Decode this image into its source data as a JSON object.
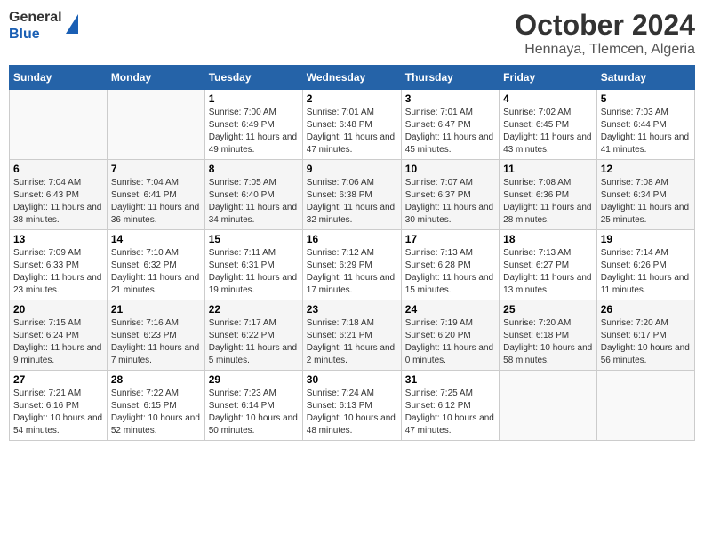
{
  "header": {
    "logo_general": "General",
    "logo_blue": "Blue",
    "month_title": "October 2024",
    "location": "Hennaya, Tlemcen, Algeria"
  },
  "weekdays": [
    "Sunday",
    "Monday",
    "Tuesday",
    "Wednesday",
    "Thursday",
    "Friday",
    "Saturday"
  ],
  "weeks": [
    [
      {
        "day": "",
        "sunrise": "",
        "sunset": "",
        "daylight": ""
      },
      {
        "day": "",
        "sunrise": "",
        "sunset": "",
        "daylight": ""
      },
      {
        "day": "1",
        "sunrise": "Sunrise: 7:00 AM",
        "sunset": "Sunset: 6:49 PM",
        "daylight": "Daylight: 11 hours and 49 minutes."
      },
      {
        "day": "2",
        "sunrise": "Sunrise: 7:01 AM",
        "sunset": "Sunset: 6:48 PM",
        "daylight": "Daylight: 11 hours and 47 minutes."
      },
      {
        "day": "3",
        "sunrise": "Sunrise: 7:01 AM",
        "sunset": "Sunset: 6:47 PM",
        "daylight": "Daylight: 11 hours and 45 minutes."
      },
      {
        "day": "4",
        "sunrise": "Sunrise: 7:02 AM",
        "sunset": "Sunset: 6:45 PM",
        "daylight": "Daylight: 11 hours and 43 minutes."
      },
      {
        "day": "5",
        "sunrise": "Sunrise: 7:03 AM",
        "sunset": "Sunset: 6:44 PM",
        "daylight": "Daylight: 11 hours and 41 minutes."
      }
    ],
    [
      {
        "day": "6",
        "sunrise": "Sunrise: 7:04 AM",
        "sunset": "Sunset: 6:43 PM",
        "daylight": "Daylight: 11 hours and 38 minutes."
      },
      {
        "day": "7",
        "sunrise": "Sunrise: 7:04 AM",
        "sunset": "Sunset: 6:41 PM",
        "daylight": "Daylight: 11 hours and 36 minutes."
      },
      {
        "day": "8",
        "sunrise": "Sunrise: 7:05 AM",
        "sunset": "Sunset: 6:40 PM",
        "daylight": "Daylight: 11 hours and 34 minutes."
      },
      {
        "day": "9",
        "sunrise": "Sunrise: 7:06 AM",
        "sunset": "Sunset: 6:38 PM",
        "daylight": "Daylight: 11 hours and 32 minutes."
      },
      {
        "day": "10",
        "sunrise": "Sunrise: 7:07 AM",
        "sunset": "Sunset: 6:37 PM",
        "daylight": "Daylight: 11 hours and 30 minutes."
      },
      {
        "day": "11",
        "sunrise": "Sunrise: 7:08 AM",
        "sunset": "Sunset: 6:36 PM",
        "daylight": "Daylight: 11 hours and 28 minutes."
      },
      {
        "day": "12",
        "sunrise": "Sunrise: 7:08 AM",
        "sunset": "Sunset: 6:34 PM",
        "daylight": "Daylight: 11 hours and 25 minutes."
      }
    ],
    [
      {
        "day": "13",
        "sunrise": "Sunrise: 7:09 AM",
        "sunset": "Sunset: 6:33 PM",
        "daylight": "Daylight: 11 hours and 23 minutes."
      },
      {
        "day": "14",
        "sunrise": "Sunrise: 7:10 AM",
        "sunset": "Sunset: 6:32 PM",
        "daylight": "Daylight: 11 hours and 21 minutes."
      },
      {
        "day": "15",
        "sunrise": "Sunrise: 7:11 AM",
        "sunset": "Sunset: 6:31 PM",
        "daylight": "Daylight: 11 hours and 19 minutes."
      },
      {
        "day": "16",
        "sunrise": "Sunrise: 7:12 AM",
        "sunset": "Sunset: 6:29 PM",
        "daylight": "Daylight: 11 hours and 17 minutes."
      },
      {
        "day": "17",
        "sunrise": "Sunrise: 7:13 AM",
        "sunset": "Sunset: 6:28 PM",
        "daylight": "Daylight: 11 hours and 15 minutes."
      },
      {
        "day": "18",
        "sunrise": "Sunrise: 7:13 AM",
        "sunset": "Sunset: 6:27 PM",
        "daylight": "Daylight: 11 hours and 13 minutes."
      },
      {
        "day": "19",
        "sunrise": "Sunrise: 7:14 AM",
        "sunset": "Sunset: 6:26 PM",
        "daylight": "Daylight: 11 hours and 11 minutes."
      }
    ],
    [
      {
        "day": "20",
        "sunrise": "Sunrise: 7:15 AM",
        "sunset": "Sunset: 6:24 PM",
        "daylight": "Daylight: 11 hours and 9 minutes."
      },
      {
        "day": "21",
        "sunrise": "Sunrise: 7:16 AM",
        "sunset": "Sunset: 6:23 PM",
        "daylight": "Daylight: 11 hours and 7 minutes."
      },
      {
        "day": "22",
        "sunrise": "Sunrise: 7:17 AM",
        "sunset": "Sunset: 6:22 PM",
        "daylight": "Daylight: 11 hours and 5 minutes."
      },
      {
        "day": "23",
        "sunrise": "Sunrise: 7:18 AM",
        "sunset": "Sunset: 6:21 PM",
        "daylight": "Daylight: 11 hours and 2 minutes."
      },
      {
        "day": "24",
        "sunrise": "Sunrise: 7:19 AM",
        "sunset": "Sunset: 6:20 PM",
        "daylight": "Daylight: 11 hours and 0 minutes."
      },
      {
        "day": "25",
        "sunrise": "Sunrise: 7:20 AM",
        "sunset": "Sunset: 6:18 PM",
        "daylight": "Daylight: 10 hours and 58 minutes."
      },
      {
        "day": "26",
        "sunrise": "Sunrise: 7:20 AM",
        "sunset": "Sunset: 6:17 PM",
        "daylight": "Daylight: 10 hours and 56 minutes."
      }
    ],
    [
      {
        "day": "27",
        "sunrise": "Sunrise: 7:21 AM",
        "sunset": "Sunset: 6:16 PM",
        "daylight": "Daylight: 10 hours and 54 minutes."
      },
      {
        "day": "28",
        "sunrise": "Sunrise: 7:22 AM",
        "sunset": "Sunset: 6:15 PM",
        "daylight": "Daylight: 10 hours and 52 minutes."
      },
      {
        "day": "29",
        "sunrise": "Sunrise: 7:23 AM",
        "sunset": "Sunset: 6:14 PM",
        "daylight": "Daylight: 10 hours and 50 minutes."
      },
      {
        "day": "30",
        "sunrise": "Sunrise: 7:24 AM",
        "sunset": "Sunset: 6:13 PM",
        "daylight": "Daylight: 10 hours and 48 minutes."
      },
      {
        "day": "31",
        "sunrise": "Sunrise: 7:25 AM",
        "sunset": "Sunset: 6:12 PM",
        "daylight": "Daylight: 10 hours and 47 minutes."
      },
      {
        "day": "",
        "sunrise": "",
        "sunset": "",
        "daylight": ""
      },
      {
        "day": "",
        "sunrise": "",
        "sunset": "",
        "daylight": ""
      }
    ]
  ]
}
